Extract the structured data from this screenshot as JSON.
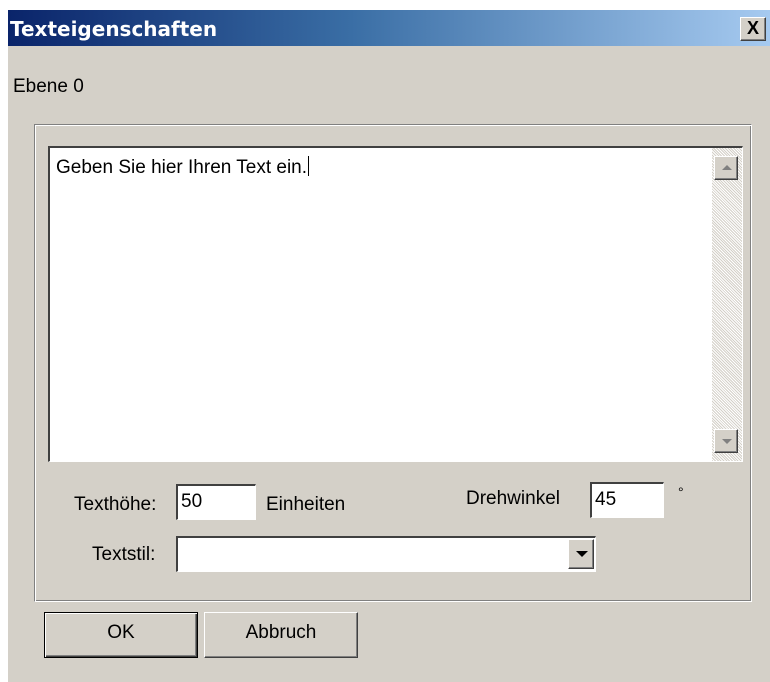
{
  "window": {
    "title": "Texteigenschaften",
    "close_label": "X"
  },
  "layer": {
    "label": "Ebene 0"
  },
  "text_input": {
    "value": "Geben Sie hier Ihren Text ein."
  },
  "text_height": {
    "label": "Texthöhe:",
    "value": "50",
    "unit": "Einheiten"
  },
  "rotation": {
    "label": "Drehwinkel",
    "value": "45",
    "unit": "°"
  },
  "text_style": {
    "label": "Textstil:",
    "value": ""
  },
  "buttons": {
    "ok": "OK",
    "cancel": "Abbruch"
  },
  "colors": {
    "face": "#d4d0c8",
    "title_start": "#0a246a",
    "title_end": "#a6caf0"
  }
}
